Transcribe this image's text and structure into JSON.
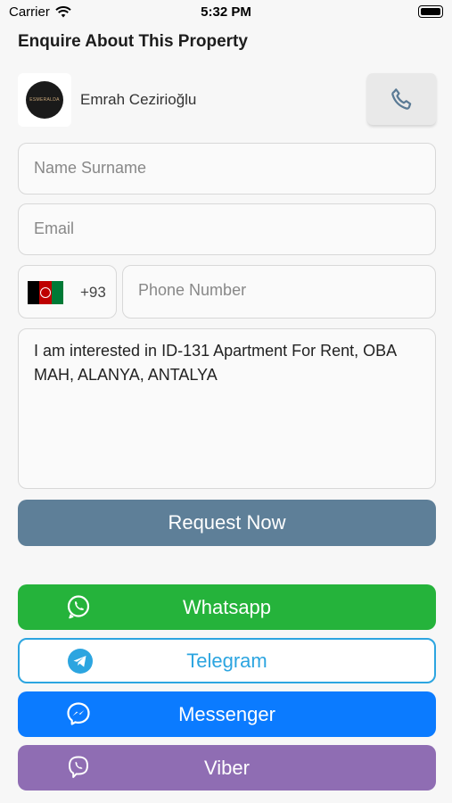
{
  "status": {
    "carrier": "Carrier",
    "time": "5:32 PM"
  },
  "title": "Enquire About This Property",
  "agent": {
    "name": "Emrah Cezirioğlu",
    "logo_text": "ESMERALDA"
  },
  "form": {
    "name_placeholder": "Name Surname",
    "email_placeholder": "Email",
    "country_code": "+93",
    "phone_placeholder": "Phone Number",
    "message": "I am interested in ID-131 Apartment For Rent, OBA MAH, ALANYA, ANTALYA"
  },
  "request_button": "Request Now",
  "share": {
    "whatsapp": "Whatsapp",
    "telegram": "Telegram",
    "messenger": "Messenger",
    "viber": "Viber"
  },
  "colors": {
    "accent": "#5e7f98",
    "whatsapp": "#25b33b",
    "telegram": "#2ca5e0",
    "messenger": "#0b7bff",
    "viber": "#8f6db3"
  },
  "icons": [
    "wifi-icon",
    "battery-icon",
    "phone-icon",
    "afghanistan-flag-icon",
    "whatsapp-icon",
    "telegram-icon",
    "messenger-icon",
    "viber-icon"
  ]
}
